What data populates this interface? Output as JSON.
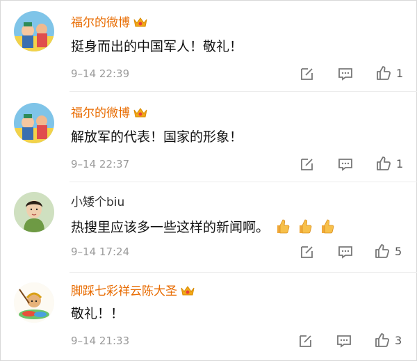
{
  "accent_color": "#e86b00",
  "comments": [
    {
      "username": "福尔的微博",
      "vip": true,
      "text": "挺身而出的中国军人！敬礼！",
      "time": "9–14 22:39",
      "likes": "1",
      "emojis": 0
    },
    {
      "username": "福尔的微博",
      "vip": true,
      "text": "解放军的代表！国家的形象！",
      "time": "9–14 22:37",
      "likes": "1",
      "emojis": 0
    },
    {
      "username": "小矮个biu",
      "vip": false,
      "text": "热搜里应该多一些这样的新闻啊。",
      "time": "9–14 17:24",
      "likes": "5",
      "emojis": 3
    },
    {
      "username": "脚踩七彩祥云陈大圣",
      "vip": true,
      "text": "敬礼！！",
      "time": "9–14 21:33",
      "likes": "3",
      "emojis": 0
    }
  ],
  "icons": {
    "edit": "edit-icon",
    "reply": "comment-icon",
    "like": "thumbs-up-icon",
    "vip": "crown-icon",
    "emoji": "thumbs-up-emoji"
  }
}
